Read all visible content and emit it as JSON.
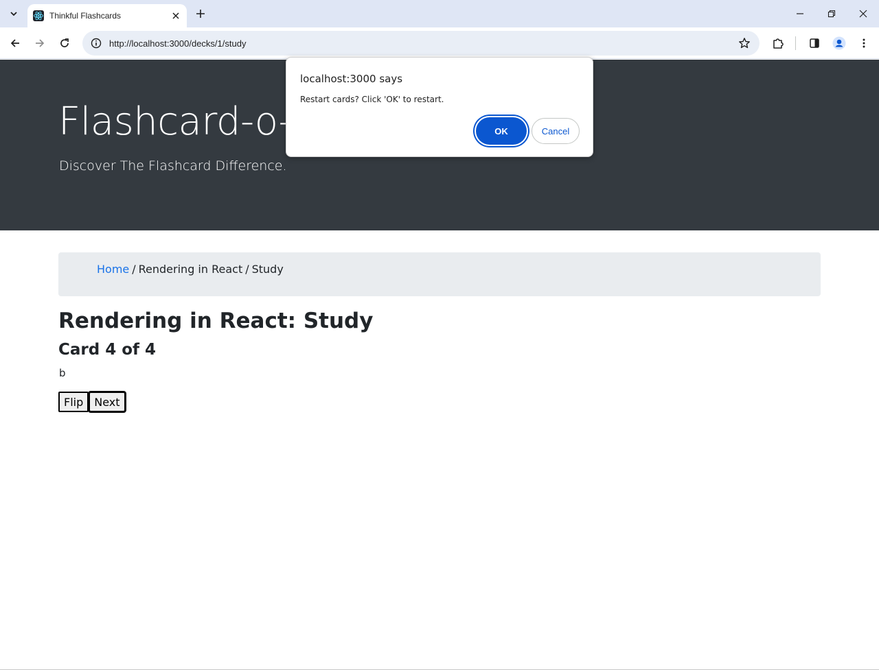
{
  "browser": {
    "tab_title": "Thinkful Flashcards",
    "url": "http://localhost:3000/decks/1/study",
    "icons": {
      "tab_search": "chevron-down-icon",
      "favicon": "react-logo-icon",
      "tab_close": "close-icon",
      "new_tab": "plus-icon",
      "minimize": "minimize-icon",
      "restore": "restore-icon",
      "close_window": "close-icon",
      "back": "back-arrow-icon",
      "forward": "forward-arrow-icon",
      "reload": "reload-icon",
      "site_info": "info-icon",
      "bookmark": "star-icon",
      "extensions": "puzzle-icon",
      "side_panel": "side-panel-icon",
      "profile": "profile-icon",
      "menu": "kebab-menu-icon"
    }
  },
  "header": {
    "title": "Flashcard-o-matic",
    "subtitle": "Discover The Flashcard Difference."
  },
  "breadcrumb": {
    "home": "Home",
    "separator": "/",
    "deck": "Rendering in React",
    "current": "Study"
  },
  "study": {
    "title": "Rendering in React: Study",
    "card_counter": "Card 4 of 4",
    "card_text": "b",
    "flip_label": "Flip",
    "next_label": "Next"
  },
  "dialog": {
    "title": "localhost:3000 says",
    "message": "Restart cards? Click 'OK' to restart.",
    "ok_label": "OK",
    "cancel_label": "Cancel"
  },
  "colors": {
    "jumbotron_bg": "#343a40",
    "breadcrumb_bg": "#e9ecef",
    "link": "#1a73e8",
    "dialog_primary": "#0b57d0"
  }
}
